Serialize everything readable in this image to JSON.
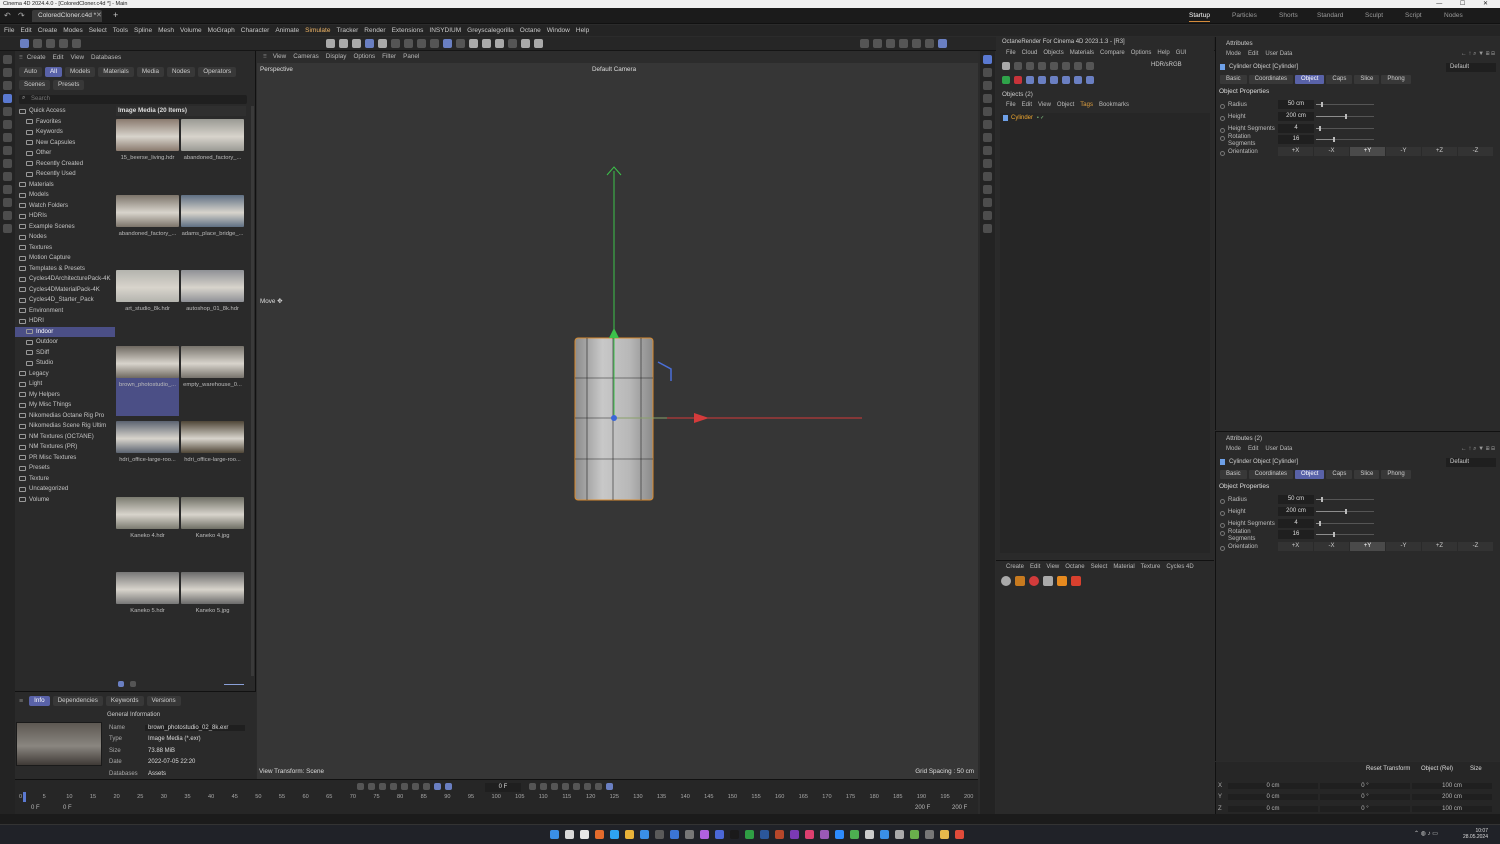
{
  "window": {
    "title": "Cinema 4D 2024.4.0 - [ColoredCloner.c4d *] - Main"
  },
  "doc_tab": "ColoredCloner.c4d *",
  "layouts": [
    {
      "label": "Startup",
      "selected": true
    },
    {
      "label": "Particles"
    },
    {
      "label": "Shorts"
    },
    {
      "label": "Standard"
    },
    {
      "label": "Sculpt"
    },
    {
      "label": "Script"
    },
    {
      "label": "Nodes"
    }
  ],
  "menu": [
    "File",
    "Edit",
    "Create",
    "Modes",
    "Select",
    "Tools",
    "Spline",
    "Mesh",
    "Volume",
    "MoGraph",
    "Character",
    "Animate",
    "Simulate",
    "Tracker",
    "Render",
    "Extensions",
    "INSYDIUM",
    "Greyscalegorilla",
    "Octane",
    "Window",
    "Help"
  ],
  "asset_browser": {
    "menu": [
      "Create",
      "Edit",
      "View",
      "Databases"
    ],
    "filters": [
      {
        "label": "Auto"
      },
      {
        "label": "All",
        "selected": true
      },
      {
        "label": "Models"
      },
      {
        "label": "Materials"
      },
      {
        "label": "Media"
      },
      {
        "label": "Nodes"
      },
      {
        "label": "Operators"
      }
    ],
    "scene_tabs": [
      "Scenes",
      "Presets"
    ],
    "search_placeholder": "Search",
    "tree": [
      {
        "label": "Quick Access",
        "level": 0
      },
      {
        "label": "Favorites",
        "level": 1
      },
      {
        "label": "Keywords",
        "level": 1
      },
      {
        "label": "New Capsules",
        "level": 1
      },
      {
        "label": "Other",
        "level": 1
      },
      {
        "label": "Recently Created",
        "level": 1
      },
      {
        "label": "Recently Used",
        "level": 1
      },
      {
        "label": "Materials",
        "level": 0
      },
      {
        "label": "Models",
        "level": 0
      },
      {
        "label": "Watch Folders",
        "level": 0
      },
      {
        "label": "HDRIs",
        "level": 0
      },
      {
        "label": "Example Scenes",
        "level": 0
      },
      {
        "label": "Nodes",
        "level": 0
      },
      {
        "label": "Textures",
        "level": 0
      },
      {
        "label": "Motion Capture",
        "level": 0
      },
      {
        "label": "Templates & Presets",
        "level": 0
      },
      {
        "label": "Cycles4DArchitecturePack-4K",
        "level": 0
      },
      {
        "label": "Cycles4DMaterialPack-4K",
        "level": 0
      },
      {
        "label": "Cycles4D_Starter_Pack",
        "level": 0
      },
      {
        "label": "Environment",
        "level": 0
      },
      {
        "label": "HDRI",
        "level": 0
      },
      {
        "label": "Indoor",
        "level": 1,
        "selected": true
      },
      {
        "label": "Outdoor",
        "level": 1
      },
      {
        "label": "SDiff",
        "level": 1
      },
      {
        "label": "Studio",
        "level": 1
      },
      {
        "label": "Legacy",
        "level": 0
      },
      {
        "label": "Light",
        "level": 0
      },
      {
        "label": "My Helpers",
        "level": 0
      },
      {
        "label": "My Misc Things",
        "level": 0
      },
      {
        "label": "Nikomedias Octane Rig Pro",
        "level": 0
      },
      {
        "label": "Nikomedias Scene Rig Ultim",
        "level": 0
      },
      {
        "label": "NM Textures (OCTANE)",
        "level": 0
      },
      {
        "label": "NM Textures (PR)",
        "level": 0
      },
      {
        "label": "PR Misc Textures",
        "level": 0
      },
      {
        "label": "Presets",
        "level": 0
      },
      {
        "label": "Texture",
        "level": 0
      },
      {
        "label": "Uncategorized",
        "level": 0
      },
      {
        "label": "Volume",
        "level": 0
      }
    ],
    "grid_header": "Image Media (20 Items)",
    "thumbs": [
      {
        "label": "15_beerse_living.hdr",
        "color": "#8a7a6e"
      },
      {
        "label": "abandoned_factory_...",
        "color": "#9a9a94"
      },
      {
        "label": "abandoned_factory_...",
        "color": "#7c746a"
      },
      {
        "label": "adams_place_bridge_...",
        "color": "#5f6f83"
      },
      {
        "label": "art_studio_8k.hdr",
        "color": "#b4b4ae"
      },
      {
        "label": "autoshop_01_8k.hdr",
        "color": "#8f9196"
      },
      {
        "label": "brown_photostudio_...",
        "color": "#6e6860",
        "selected": true
      },
      {
        "label": "empty_warehouse_0...",
        "color": "#77736c"
      },
      {
        "label": "hdri_office-large-roo...",
        "color": "#5b6370"
      },
      {
        "label": "hdri_office-large-roo...",
        "color": "#4f4637"
      },
      {
        "label": "Kaneko 4.hdr",
        "color": "#7b7b70"
      },
      {
        "label": "Kaneko 4.jpg",
        "color": "#6e6e64"
      },
      {
        "label": "Kaneko 5.hdr",
        "color": "#777777"
      },
      {
        "label": "Kaneko 5.jpg",
        "color": "#6a6a6a"
      }
    ],
    "info_tabs": [
      {
        "label": "Info",
        "selected": true
      },
      {
        "label": "Dependencies"
      },
      {
        "label": "Keywords"
      },
      {
        "label": "Versions"
      }
    ],
    "info": {
      "section": "General Information",
      "fields": [
        {
          "label": "Name",
          "value": "brown_photostudio_02_8k.exr"
        },
        {
          "label": "Type",
          "value": "Image Media (*.exr)"
        },
        {
          "label": "Size",
          "value": "73.88 MiB"
        },
        {
          "label": "Date",
          "value": "2022-07-05 22:20"
        },
        {
          "label": "Databases",
          "value": "Assets"
        }
      ]
    }
  },
  "viewport": {
    "menu": [
      "View",
      "Cameras",
      "Display",
      "Options",
      "Filter",
      "Panel"
    ],
    "name": "Perspective",
    "camera": "Default Camera",
    "tool_hint": "Move",
    "view_transform": "View Transform: Scene",
    "grid_spacing": "Grid Spacing : 50 cm"
  },
  "timeline": {
    "frame_field": "0 F",
    "ticks": [
      "0",
      "5",
      "10",
      "15",
      "20",
      "25",
      "30",
      "35",
      "40",
      "45",
      "50",
      "55",
      "60",
      "65",
      "70",
      "75",
      "80",
      "85",
      "90",
      "95",
      "100",
      "105",
      "110",
      "115",
      "120",
      "125",
      "130",
      "135",
      "140",
      "145",
      "150",
      "155",
      "160",
      "165",
      "170",
      "175",
      "180",
      "185",
      "190",
      "195",
      "200"
    ],
    "start_a": "0 F",
    "start_b": "0 F",
    "end_a": "200 F",
    "end_b": "200 F"
  },
  "octane": {
    "title": "OctaneRender For Cinema 4D 2023.1.3 - [R3]",
    "menu": [
      "File",
      "Cloud",
      "Objects",
      "Materials",
      "Compare",
      "Options",
      "Help",
      "GUI"
    ],
    "color_space": "HDR/sRGB"
  },
  "objects": {
    "title": "Objects (2)",
    "menu": [
      "File",
      "Edit",
      "View",
      "Object",
      "Tags",
      "Bookmarks"
    ],
    "item": "Cylinder"
  },
  "materials": {
    "menu": [
      "Create",
      "Edit",
      "View",
      "Octane",
      "Select",
      "Material",
      "Texture",
      "Cycles 4D"
    ]
  },
  "attributes": [
    {
      "title": "Attributes",
      "menu": [
        "Mode",
        "Edit",
        "User Data"
      ],
      "object": "Cylinder Object [Cylinder]",
      "preset": "Default",
      "tabs": [
        {
          "label": "Basic"
        },
        {
          "label": "Coordinates"
        },
        {
          "label": "Object",
          "selected": true
        },
        {
          "label": "Caps"
        },
        {
          "label": "Slice"
        },
        {
          "label": "Phong"
        }
      ],
      "section": "Object Properties",
      "props": [
        {
          "label": "Radius",
          "value": "50 cm",
          "fill": 0.08
        },
        {
          "label": "Height",
          "value": "200 cm",
          "fill": 0.5
        },
        {
          "label": "Height Segments",
          "value": "4",
          "fill": 0.05
        },
        {
          "label": "Rotation Segments",
          "value": "16",
          "fill": 0.3
        }
      ],
      "orientation_label": "Orientation",
      "orientation": [
        {
          "label": "+X"
        },
        {
          "label": "-X"
        },
        {
          "label": "+Y",
          "selected": true
        },
        {
          "label": "-Y"
        },
        {
          "label": "+Z"
        },
        {
          "label": "-Z"
        }
      ]
    },
    {
      "title": "Attributes (2)",
      "menu": [
        "Mode",
        "Edit",
        "User Data"
      ],
      "object": "Cylinder Object [Cylinder]",
      "preset": "Default",
      "tabs": [
        {
          "label": "Basic"
        },
        {
          "label": "Coordinates"
        },
        {
          "label": "Object",
          "selected": true
        },
        {
          "label": "Caps"
        },
        {
          "label": "Slice"
        },
        {
          "label": "Phong"
        }
      ],
      "section": "Object Properties",
      "props": [
        {
          "label": "Radius",
          "value": "50 cm",
          "fill": 0.08
        },
        {
          "label": "Height",
          "value": "200 cm",
          "fill": 0.5
        },
        {
          "label": "Height Segments",
          "value": "4",
          "fill": 0.05
        },
        {
          "label": "Rotation Segments",
          "value": "16",
          "fill": 0.3
        }
      ],
      "orientation_label": "Orientation",
      "orientation": [
        {
          "label": "+X"
        },
        {
          "label": "-X"
        },
        {
          "label": "+Y",
          "selected": true
        },
        {
          "label": "-Y"
        },
        {
          "label": "+Z"
        },
        {
          "label": "-Z"
        }
      ]
    }
  ],
  "coords": {
    "reset": "Reset Transform",
    "mode": "Object (Rel)",
    "size_mode": "Size",
    "rows": [
      {
        "axis": "X",
        "pos": "0 cm",
        "rot": "0 °",
        "size": "100 cm"
      },
      {
        "axis": "Y",
        "pos": "0 cm",
        "rot": "0 °",
        "size": "200 cm"
      },
      {
        "axis": "Z",
        "pos": "0 cm",
        "rot": "0 °",
        "size": "100 cm"
      }
    ]
  },
  "clock": {
    "time": "10:07",
    "date": "28.05.2024"
  },
  "taskbar_colors": [
    "#3a8ee6",
    "#d9d9d9",
    "#e6e6e6",
    "#e46b2c",
    "#2ea3f2",
    "#e8b339",
    "#3a8ee6",
    "#5a5a5a",
    "#3b76d6",
    "#777",
    "#b061e0",
    "#4b68d8",
    "#1a1a1a",
    "#2f9e44",
    "#2b579a",
    "#b7472a",
    "#7b3ab5",
    "#dd3f6f",
    "#9b59b6",
    "#2d8cff",
    "#4caf50",
    "#cccccc",
    "#3a8ee6",
    "#aaaaaa",
    "#6ab04c",
    "#777",
    "#e6b94c",
    "#e04b3a"
  ]
}
